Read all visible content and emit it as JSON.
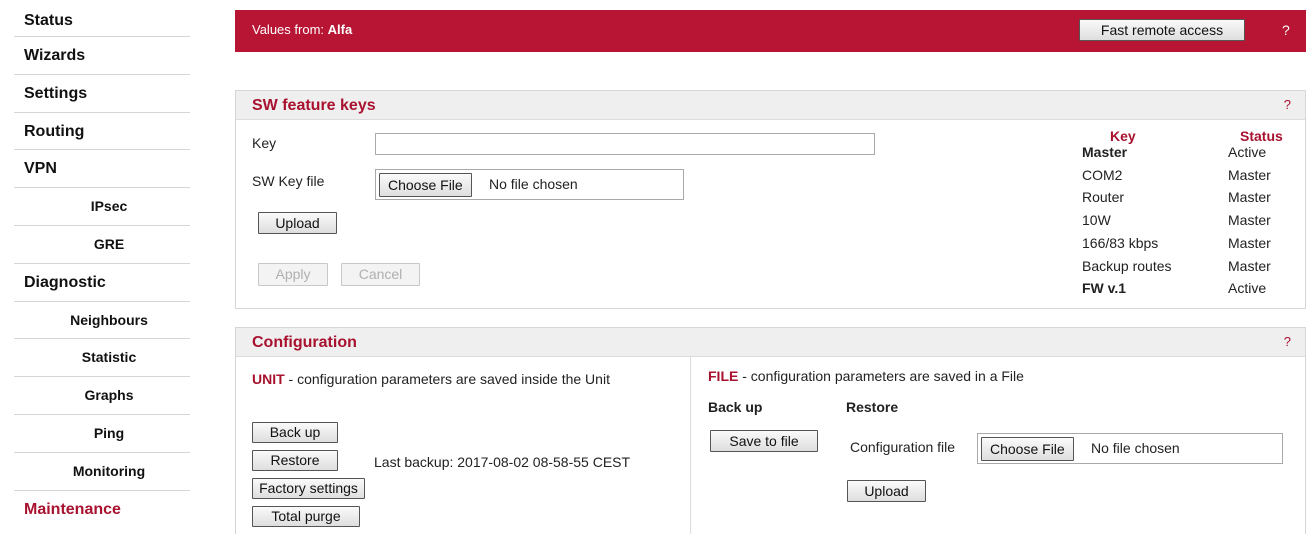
{
  "sidebar": {
    "items": [
      {
        "label": "Status"
      },
      {
        "label": "Wizards"
      },
      {
        "label": "Settings"
      },
      {
        "label": "Routing"
      },
      {
        "label": "VPN"
      },
      {
        "label": "IPsec"
      },
      {
        "label": "GRE"
      },
      {
        "label": "Diagnostic"
      },
      {
        "label": "Neighbours"
      },
      {
        "label": "Statistic"
      },
      {
        "label": "Graphs"
      },
      {
        "label": "Ping"
      },
      {
        "label": "Monitoring"
      },
      {
        "label": "Maintenance"
      }
    ]
  },
  "header": {
    "values_prefix": "Values from:",
    "unit_name": "Alfa",
    "fast_remote_access": "Fast remote access",
    "help": "?"
  },
  "sw_keys": {
    "title": "SW feature keys",
    "help": "?",
    "key_label": "Key",
    "key_value": "",
    "file_label": "SW Key file",
    "choose_file": "Choose File",
    "no_file": "No file chosen",
    "upload": "Upload",
    "apply": "Apply",
    "cancel": "Cancel",
    "table": {
      "col_key": "Key",
      "col_status": "Status",
      "rows": [
        {
          "key": "Master",
          "status": "Active"
        },
        {
          "key": "COM2",
          "status": "Master"
        },
        {
          "key": "Router",
          "status": "Master"
        },
        {
          "key": "10W",
          "status": "Master"
        },
        {
          "key": "166/83 kbps",
          "status": "Master"
        },
        {
          "key": "Backup routes",
          "status": "Master"
        },
        {
          "key": "FW v.1",
          "status": "Active"
        }
      ]
    }
  },
  "configuration": {
    "title": "Configuration",
    "help": "?",
    "unit_word": "UNIT",
    "unit_desc": " - configuration parameters are saved inside the Unit",
    "backup": "Back up",
    "restore": "Restore",
    "factory": "Factory settings",
    "purge": "Total purge",
    "last_backup": "Last backup: 2017-08-02 08-58-55 CEST",
    "file_word": "FILE",
    "file_desc": " - configuration parameters are saved in a File",
    "backup_head": "Back up",
    "restore_head": "Restore",
    "save_to_file": "Save to file",
    "config_file_label": "Configuration file",
    "choose_file": "Choose File",
    "no_file": "No file chosen",
    "upload": "Upload"
  }
}
